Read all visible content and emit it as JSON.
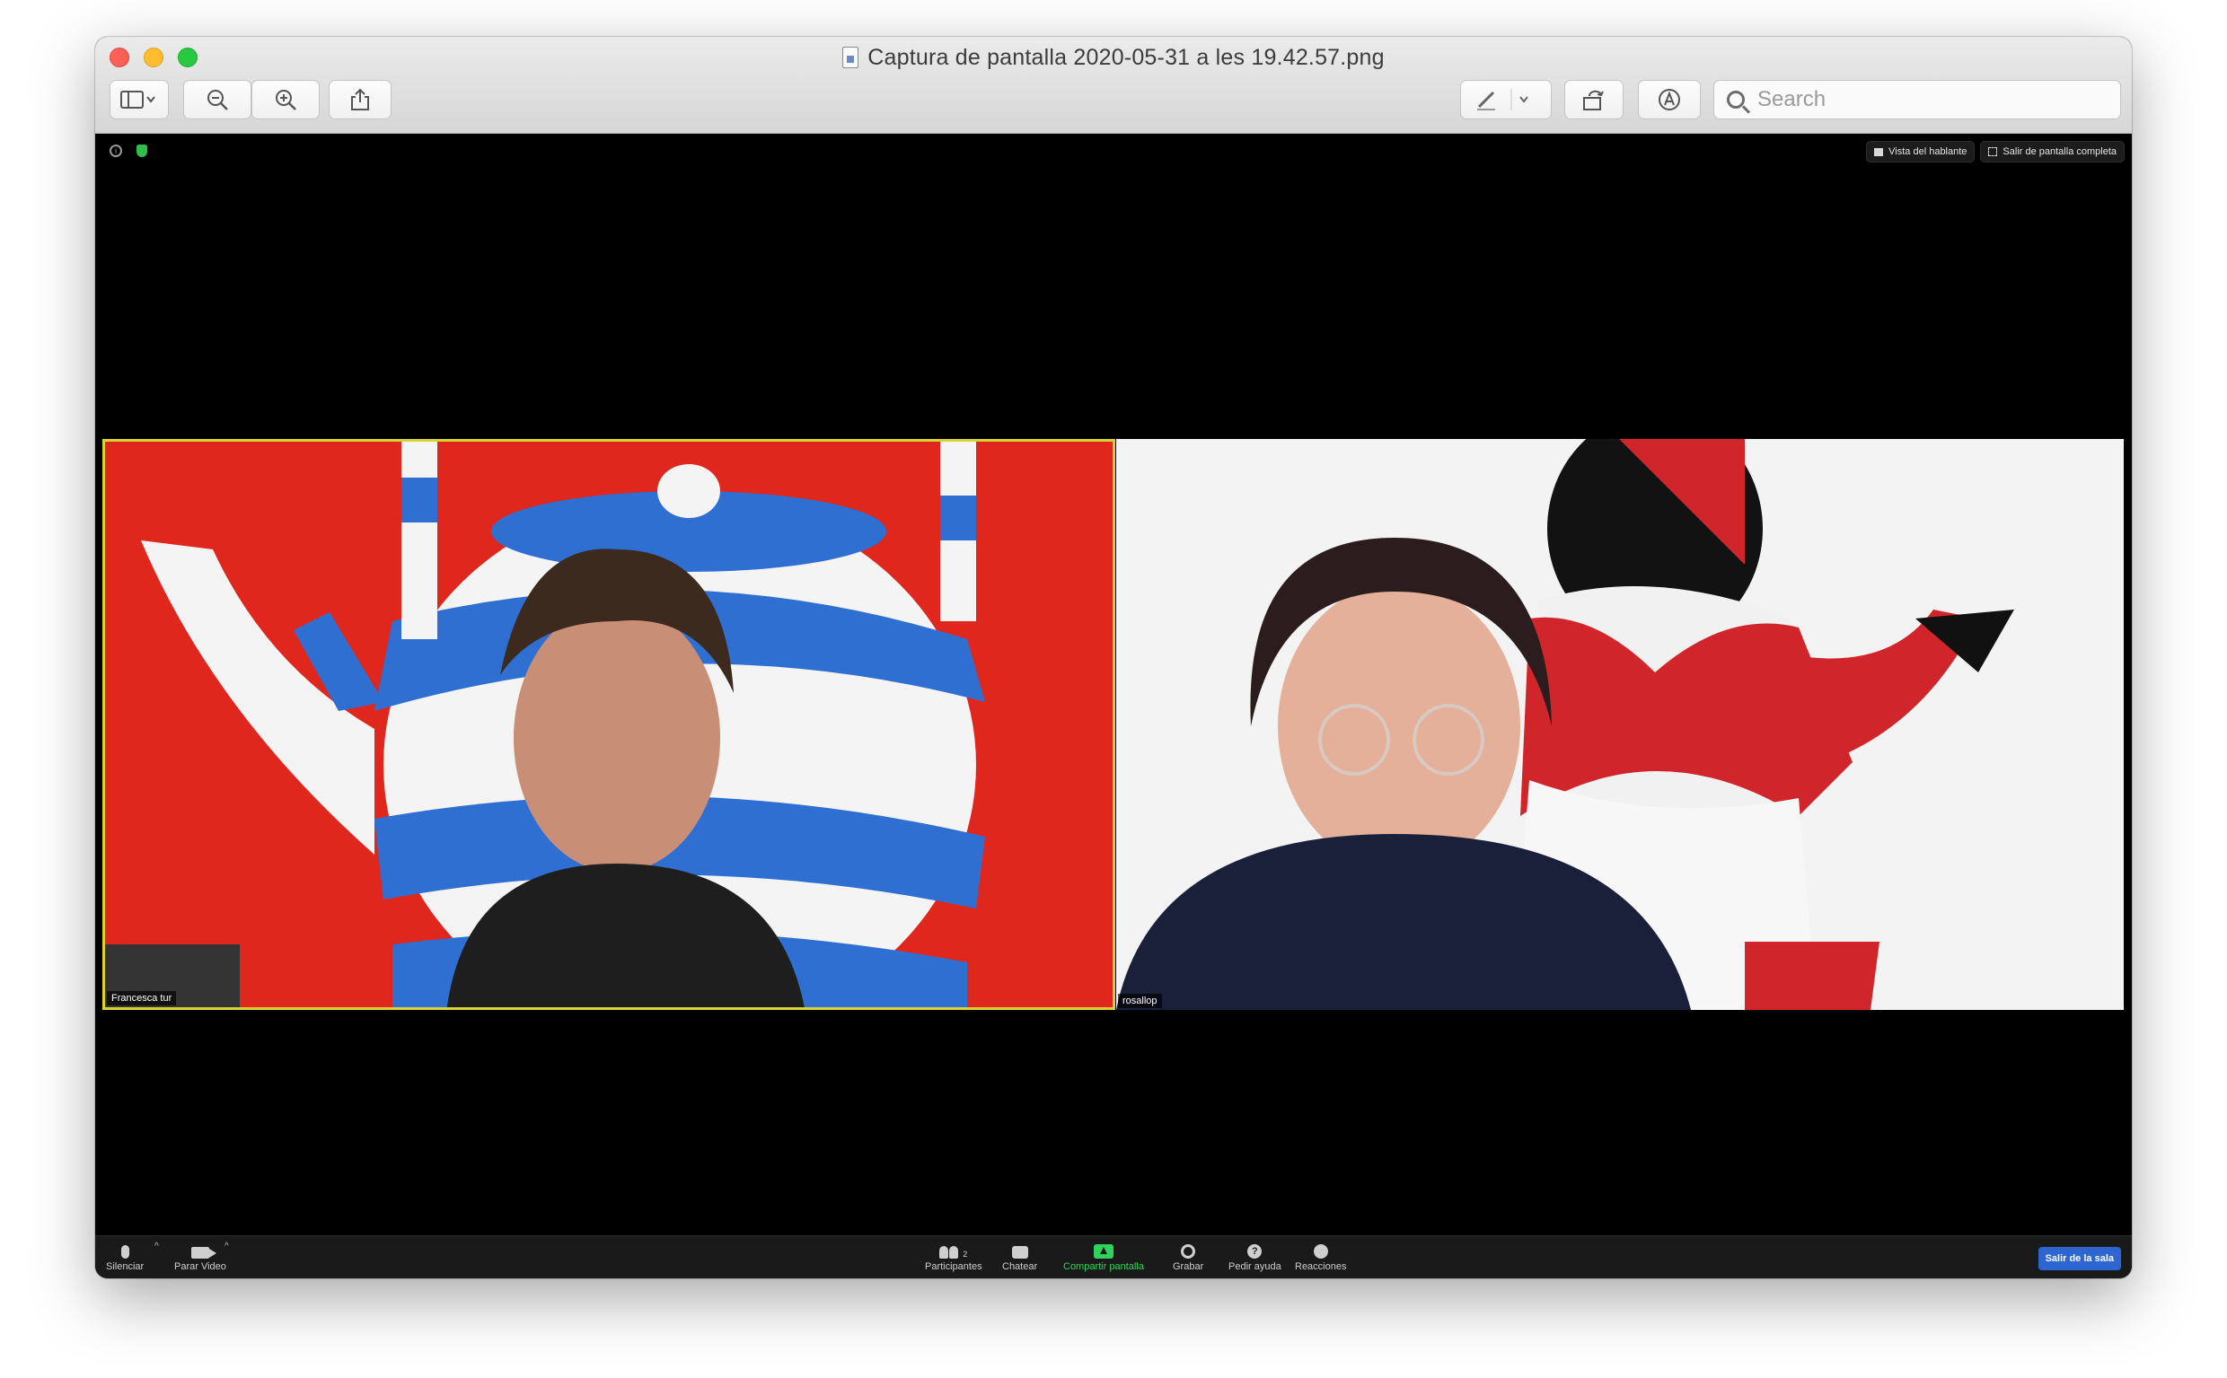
{
  "window": {
    "title": "Captura de pantalla 2020-05-31 a les 19.42.57.png",
    "search_placeholder": "Search"
  },
  "zoom": {
    "top_right": {
      "speaker_view": "Vista del hablante",
      "exit_fullscreen": "Salir de pantalla completa"
    },
    "participants": [
      {
        "name": "Francesca tur",
        "active_speaker": true
      },
      {
        "name": "rosallop",
        "active_speaker": false
      }
    ],
    "toolbar": {
      "mute": "Silenciar",
      "stop_video": "Parar Video",
      "participants": "Participantes",
      "participants_count": "2",
      "chat": "Chatear",
      "share_screen": "Compartir pantalla",
      "record": "Grabar",
      "ask_help": "Pedir ayuda",
      "reactions": "Reacciones",
      "leave": "Salir de la sala"
    }
  },
  "colors": {
    "active_speaker_border": "#d8d435",
    "share_green": "#2fd35a",
    "leave_blue": "#2d66d0",
    "tile1_background": "#e0271e"
  }
}
